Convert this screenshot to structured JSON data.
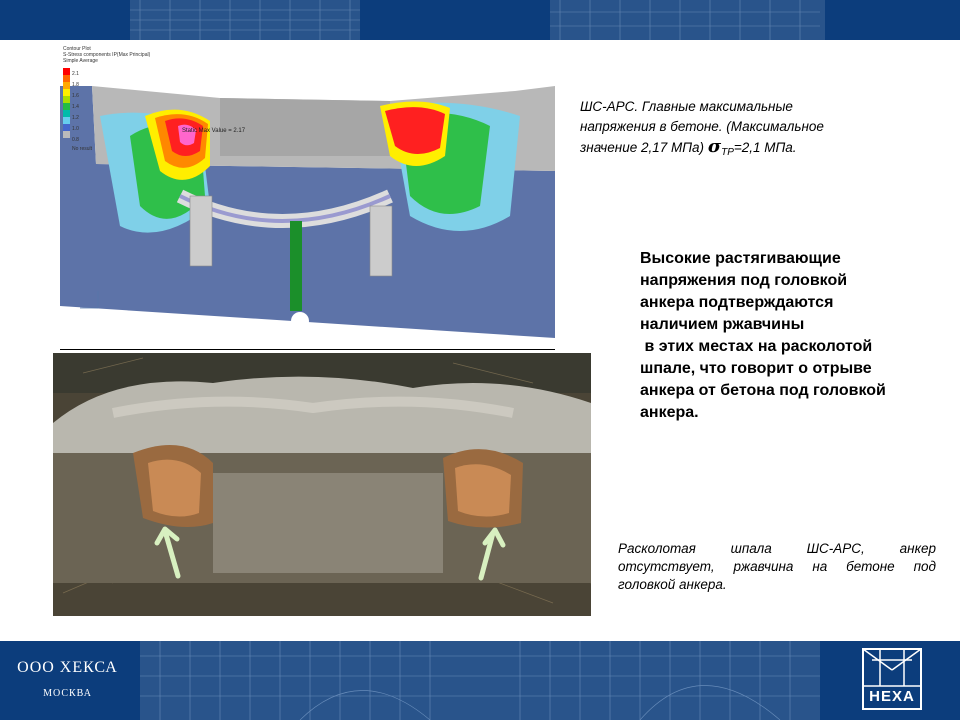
{
  "header": {
    "color": "#0c3d7c"
  },
  "footer": {
    "company": "ООО ХЕКСА",
    "city": "МОСКВА",
    "logo_text": "HEXA"
  },
  "contour_plot": {
    "meta_lines": [
      "Contour Plot",
      "S-Stress components IP(Max Principal)",
      "Simple Average"
    ],
    "legend_values": [
      "2.1",
      "1.8",
      "1.6",
      "1.4",
      "1.2",
      "1.0",
      "0.8"
    ],
    "no_result": "No result",
    "annotation": "Static Max Value = 2.17"
  },
  "caption_top": {
    "line1": "ШС-АРС. Главные максимальные",
    "line2": "напряжения в бетоне. (Максимальное",
    "line3_before": "значение 2,17 МПа) ",
    "sigma": "σ",
    "subscript": "TP",
    "line3_after": "=2,1 МПа."
  },
  "main_text": {
    "lines": [
      "Высокие растягивающие",
      "напряжения под головкой",
      "анкера подтверждаются",
      "наличием ржавчины",
      " в этих местах на расколотой",
      "шпале, что говорит о отрыве",
      "анкера от бетона под головкой",
      "анкера."
    ]
  },
  "caption_bottom": {
    "text": "Расколотая шпала ШС-АРС, анкер отсутствует, ржавчина на бетоне под головкой анкера."
  },
  "colors": {
    "accent": "#0c3d7c",
    "stress_max": "#ff0000",
    "stress_high": "#ff8800",
    "stress_mid": "#ffee00",
    "stress_low": "#22bb44",
    "stress_min": "#5a78b0"
  }
}
